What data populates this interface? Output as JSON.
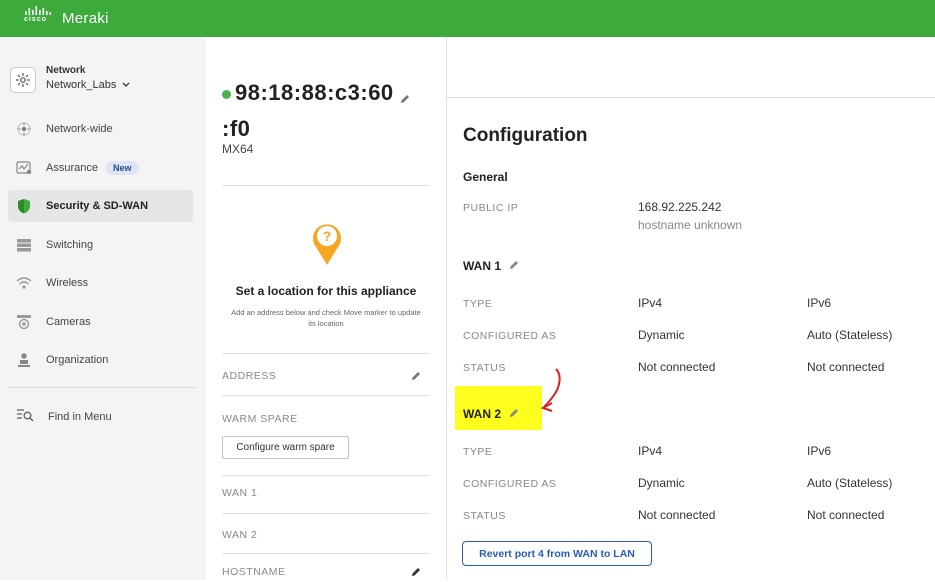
{
  "brand": {
    "cisco": "cisco",
    "product": "Meraki"
  },
  "colors": {
    "topbar": "#3cab3b",
    "status_online": "#4caf50",
    "pin": "#f5a623",
    "highlight": "#fdfd1e",
    "annotation_arrow": "#e02020",
    "link": "#2a5db0"
  },
  "sidebar": {
    "network_label": "Network",
    "network_name": "Network_Labs",
    "items": [
      {
        "label": "Network-wide",
        "icon": "network-wide-icon"
      },
      {
        "label": "Assurance",
        "icon": "assurance-icon",
        "badge": "New"
      },
      {
        "label": "Security & SD-WAN",
        "icon": "shield-icon",
        "active": true
      },
      {
        "label": "Switching",
        "icon": "switch-icon"
      },
      {
        "label": "Wireless",
        "icon": "wifi-icon"
      },
      {
        "label": "Cameras",
        "icon": "camera-icon"
      },
      {
        "label": "Organization",
        "icon": "organization-icon"
      }
    ],
    "find_in_menu": "Find in Menu"
  },
  "device": {
    "mac_line1": "98:18:88:c3:60",
    "mac_line2": ":f0",
    "model": "MX64",
    "location_title": "Set a location for this appliance",
    "location_desc": "Add an address below and check Move marker to update its location",
    "labels": {
      "address": "ADDRESS",
      "warm_spare": "WARM SPARE",
      "wan1": "WAN 1",
      "wan2": "WAN 2",
      "hostname": "HOSTNAME"
    },
    "warm_spare_button": "Configure warm spare"
  },
  "config": {
    "title": "Configuration",
    "general": {
      "heading": "General",
      "public_ip_label": "PUBLIC IP",
      "public_ip": "168.92.225.242",
      "hostname": "hostname unknown"
    },
    "wan1": {
      "heading": "WAN 1",
      "type_label": "TYPE",
      "configured_label": "CONFIGURED AS",
      "status_label": "STATUS",
      "ipv4": "IPv4",
      "ipv6": "IPv6",
      "configured_v4": "Dynamic",
      "configured_v6": "Auto (Stateless)",
      "status_v4": "Not connected",
      "status_v6": "Not connected"
    },
    "wan2": {
      "heading": "WAN 2",
      "type_label": "TYPE",
      "configured_label": "CONFIGURED AS",
      "status_label": "STATUS",
      "ipv4": "IPv4",
      "ipv6": "IPv6",
      "configured_v4": "Dynamic",
      "configured_v6": "Auto (Stateless)",
      "status_v4": "Not connected",
      "status_v6": "Not connected"
    },
    "revert_button": "Revert port 4 from WAN to LAN"
  }
}
